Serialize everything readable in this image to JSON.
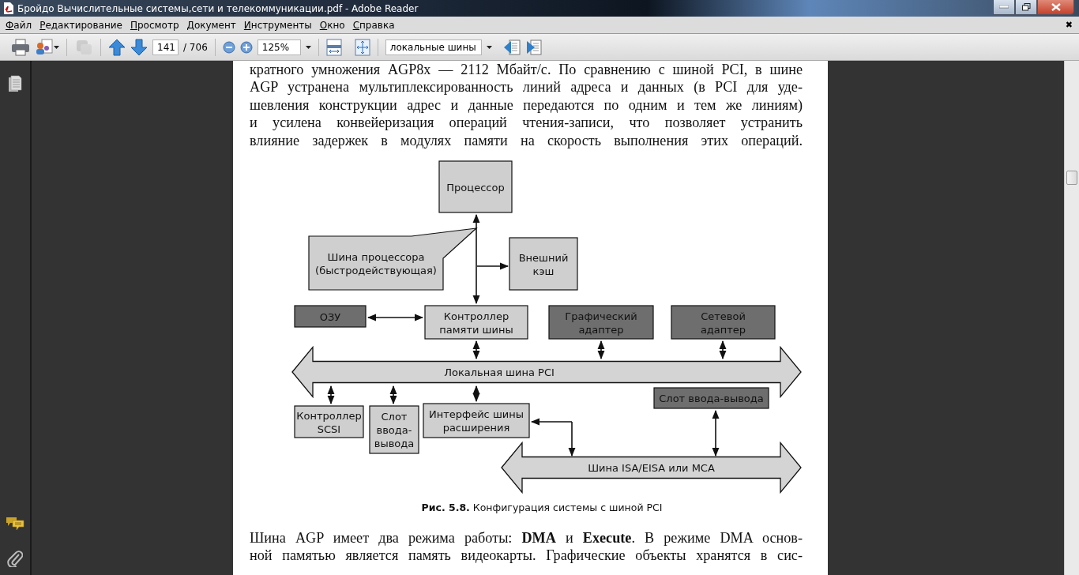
{
  "window": {
    "title": "Бройдо Вычислительные системы,сети и телекоммуникации.pdf - Adobe Reader"
  },
  "menu": [
    {
      "label": "Файл"
    },
    {
      "label": "Редактирование"
    },
    {
      "label": "Просмотр"
    },
    {
      "label": "Документ"
    },
    {
      "label": "Инструменты"
    },
    {
      "label": "Окно"
    },
    {
      "label": "Справка"
    }
  ],
  "menu_close": "✖",
  "toolbar": {
    "page": "141",
    "page_total": "/ 706",
    "zoom": "125%",
    "search": "локальные шины",
    "share_disabled": true
  },
  "document": {
    "paragraph_1": [
      "кратного умножения AGP8x — 2112 Мбайт/с. По сравнению с шиной PCI, в шине",
      "AGP устранена мультиплексированность линий адреса и данных (в PCI для уде-",
      "шевления конструкции адрес и данные передаются по одним и тем же линиям)",
      "и усилена конвейеризация операций чтения-записи, что позволяет устранить",
      "влияние задержек в модулях памяти на скорость выполнения этих операций."
    ],
    "diagram": {
      "blocks": [
        {
          "kind": "light",
          "lines": [
            "Процессор"
          ]
        },
        {
          "kind": "callout",
          "lines": [
            "Шина процессора",
            "(быстродействующая)"
          ]
        },
        {
          "kind": "light",
          "lines": [
            "Внешний",
            "кэш"
          ]
        },
        {
          "kind": "dark",
          "lines": [
            "ОЗУ"
          ]
        },
        {
          "kind": "light",
          "lines": [
            "Контроллер",
            "памяти шины"
          ]
        },
        {
          "kind": "dark",
          "lines": [
            "Графический",
            "адаптер"
          ]
        },
        {
          "kind": "dark",
          "lines": [
            "Сетевой",
            "адаптер"
          ]
        },
        {
          "kind": "light",
          "lines": [
            "Контроллер",
            "SCSI"
          ]
        },
        {
          "kind": "light",
          "lines": [
            "Слот",
            "ввода-",
            "вывода"
          ]
        },
        {
          "kind": "light",
          "lines": [
            "Интерфейс шины",
            "расширения"
          ]
        },
        {
          "kind": "dark",
          "lines": [
            "Слот ввода-вывода"
          ]
        }
      ],
      "buses": [
        {
          "label": "Локальная шина PCI"
        },
        {
          "label": "Шина ISA/EISA или MCA"
        }
      ]
    },
    "caption": "**Рис. 5.8.** Конфигурация системы с шиной PCI",
    "paragraph_2": [
      "Шина AGP имеет два режима работы: **DMA** и **Execute**. В режиме DMA основ-",
      "ной памятью является память видеокарты. Графические объекты хранятся в сис-"
    ]
  }
}
